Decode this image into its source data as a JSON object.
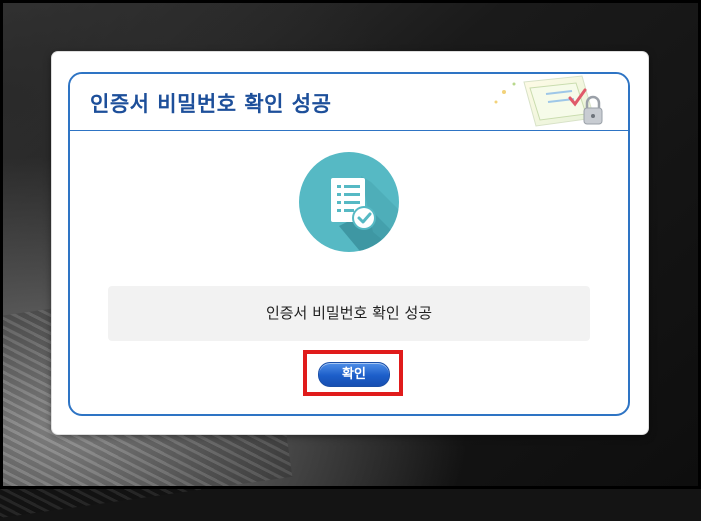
{
  "dialog": {
    "title": "인증서 비밀번호 확인 성공",
    "message": "인증서 비밀번호 확인 성공",
    "ok_label": "확인"
  },
  "icons": {
    "main": "document-check-icon",
    "decoration": "certificate-lock-icon"
  },
  "colors": {
    "title": "#1d4f9a",
    "border": "#2e74c4",
    "icon_circle": "#56b9c4",
    "button": "#1c5ec9",
    "highlight": "#e01b1b"
  }
}
